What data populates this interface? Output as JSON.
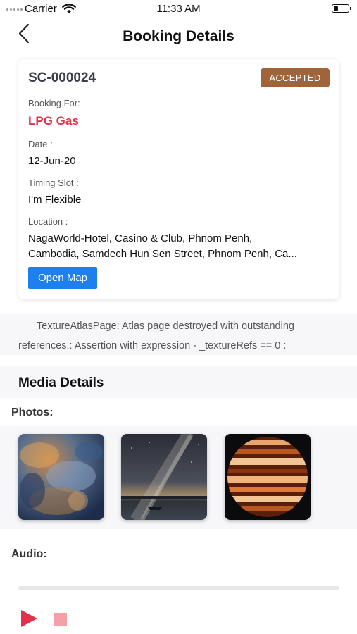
{
  "status_bar": {
    "carrier": "Carrier",
    "time": "11:33 AM",
    "battery_level": 0.3
  },
  "nav": {
    "title": "Booking Details",
    "back_icon": "chevron-left-icon"
  },
  "booking": {
    "id": "SC-000024",
    "status": "ACCEPTED",
    "status_color": "#a0643a",
    "booking_for_label": "Booking For:",
    "booking_for": "LPG Gas",
    "booking_for_color": "#e5304b",
    "date_label": "Date :",
    "date": "12-Jun-20",
    "timing_label": "Timing Slot :",
    "timing": "I'm Flexible",
    "location_label": "Location :",
    "location_line1": "NagaWorld-Hotel, Casino & Club, Phnom Penh,",
    "location_line2": "Cambodia, Samdech Hun Sen Street, Phnom Penh, Ca...",
    "open_map_label": "Open Map",
    "open_map_color": "#1e80ee"
  },
  "error_message": "TextureAtlasPage: Atlas page destroyed with outstanding references.: Assertion with expression - _textureRefs == 0 :",
  "media": {
    "title": "Media Details",
    "photos_label": "Photos:",
    "photos": [
      {
        "name": "nebula-photo"
      },
      {
        "name": "milky-way-lake-photo"
      },
      {
        "name": "jupiter-photo"
      }
    ],
    "audio_label": "Audio:",
    "audio_progress": 0,
    "play_color": "#e5304b",
    "stop_color": "#f4a0a8"
  }
}
